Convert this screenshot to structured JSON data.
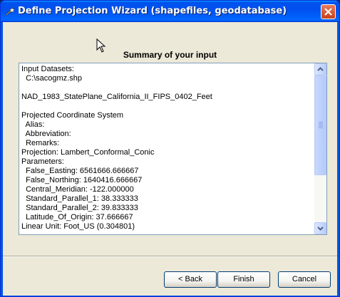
{
  "window": {
    "title": "Define Projection Wizard (shapefiles, geodatabase)"
  },
  "summary": {
    "heading": "Summary of your input",
    "lines": [
      "Input Datasets:",
      "  C:\\sacogmz.shp",
      "",
      "NAD_1983_StatePlane_California_II_FIPS_0402_Feet",
      "",
      "Projected Coordinate System",
      "  Alias:",
      "  Abbreviation:",
      "  Remarks:",
      "Projection: Lambert_Conformal_Conic",
      "Parameters:",
      "  False_Easting: 6561666.666667",
      "  False_Northing: 1640416.666667",
      "  Central_Meridian: -122.000000",
      "  Standard_Parallel_1: 38.333333",
      "  Standard_Parallel_2: 39.833333",
      "  Latitude_Of_Origin: 37.666667",
      "Linear Unit: Foot_US (0.304801)"
    ]
  },
  "buttons": {
    "back": "< Back",
    "finish": "Finish",
    "cancel": "Cancel"
  },
  "icons": {
    "title": "wand-icon",
    "close": "close-icon",
    "scroll_up": "arrow-up-icon",
    "scroll_down": "arrow-down-icon",
    "cursor": "mouse-pointer-icon"
  },
  "colors": {
    "titlebar": "#0054e3",
    "close_button": "#c7401a",
    "dialog_background": "#ece9d8",
    "listbox_border": "#7f9db9"
  }
}
